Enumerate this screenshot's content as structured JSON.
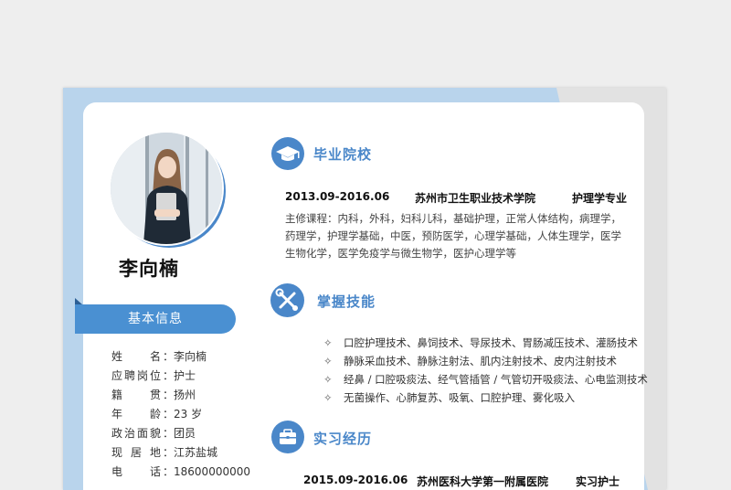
{
  "profile": {
    "name": "李向楠",
    "basic_info_title": "基本信息",
    "fields": [
      {
        "label": "姓名",
        "value": "李向楠"
      },
      {
        "label": "应聘岗位",
        "value": "护士"
      },
      {
        "label": "籍贯",
        "value": "扬州"
      },
      {
        "label": "年龄",
        "value": "23 岁"
      },
      {
        "label": "政治面貌",
        "value": "团员"
      },
      {
        "label": "现居地",
        "value": "江苏盐城"
      },
      {
        "label": "电话",
        "value": "18600000000"
      }
    ]
  },
  "education": {
    "title": "毕业院校",
    "icon": "graduation-cap-icon",
    "period": "2013.09-2016.06",
    "school": "苏州市卫生职业技术学院",
    "major": "护理学专业",
    "courses": "主修课程：内科，外科，妇科儿科，基础护理，正常人体结构，病理学，药理学，护理学基础，中医，预防医学，心理学基础，人体生理学，医学生物化学，医学免疫学与微生物学，医护心理学等"
  },
  "skills": {
    "title": "掌握技能",
    "icon": "tools-icon",
    "bullet": "✧",
    "items": [
      "口腔护理技术、鼻饲技术、导尿技术、胃肠减压技术、灌肠技术",
      "静脉采血技术、静脉注射法、肌内注射技术、皮内注射技术",
      "经鼻 / 口腔吸痰法、经气管插管 / 气管切开吸痰法、心电监测技术",
      "无菌操作、心肺复苏、吸氧、口腔护理、雾化吸入"
    ]
  },
  "internship": {
    "title": "实习经历",
    "icon": "briefcase-icon",
    "period": "2015.09-2016.06",
    "org": "苏州医科大学第一附属医院",
    "role": "实习护士"
  },
  "colors": {
    "accent": "#4a87c9",
    "ribbon": "#4a90d2",
    "frame": "#b9d4ec"
  }
}
